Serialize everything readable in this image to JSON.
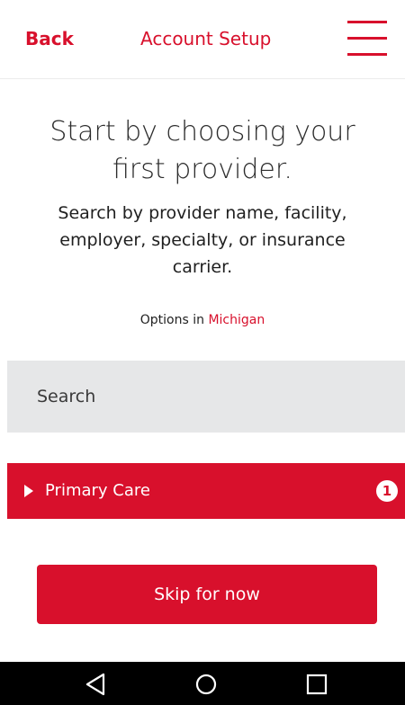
{
  "header": {
    "back_label": "Back",
    "title": "Account Setup",
    "menu_icon": "hamburger-menu-icon"
  },
  "intro": {
    "headline_line1": "Start by choosing your",
    "headline_line2": "first provider.",
    "subtext": "Search by provider name, facility, employer, specialty, or insurance carrier."
  },
  "location": {
    "prefix": "Options in",
    "state": "Michigan"
  },
  "search": {
    "placeholder": "Search",
    "value": ""
  },
  "categories": [
    {
      "label": "Primary Care",
      "count": "1",
      "expanded": false
    }
  ],
  "actions": {
    "skip_label": "Skip for now"
  },
  "system_nav": {
    "back_icon": "triangle-back-icon",
    "home_icon": "circle-home-icon",
    "recents_icon": "square-recents-icon"
  },
  "colors": {
    "accent": "#d8102c",
    "search_bg": "#e6e7e8",
    "nav_bar_bg": "#000000"
  }
}
